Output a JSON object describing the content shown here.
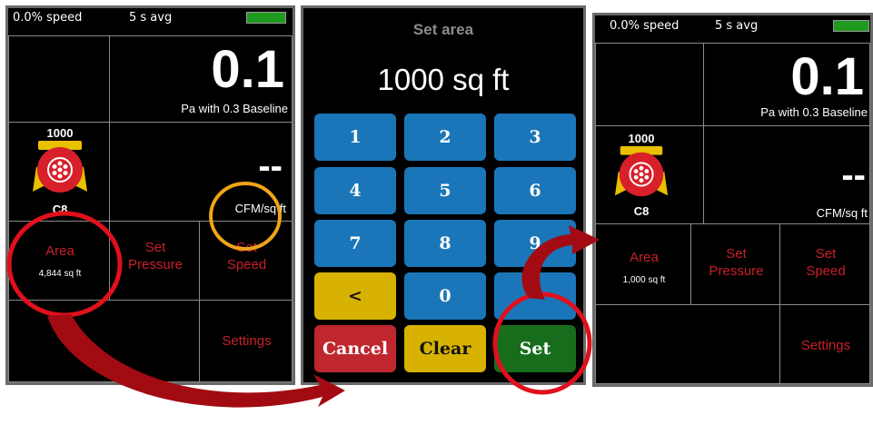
{
  "colors": {
    "background": "#000000",
    "accent_red": "#c8202a",
    "key_blue": "#1a76b8",
    "key_yellow": "#d7b200",
    "key_red": "#c0262d",
    "key_green": "#186d1c",
    "highlight_circle_red": "#e0101c",
    "highlight_circle_orange": "#f0a418"
  },
  "screen1": {
    "speed": "0.0% speed",
    "avg": "5 s avg",
    "reading": "0.1",
    "reading_unit": "Pa with 0.3  Baseline",
    "meter_label_top": "1000",
    "meter_label_bottom": "C8",
    "flow_value": "--",
    "flow_unit": "CFM/sq ft",
    "area_label": "Area",
    "area_value": "4,844 sq ft",
    "set_pressure": "Set\nPressure",
    "set_speed": "Set\nSpeed",
    "settings": "Settings"
  },
  "screen2": {
    "title": "Set area",
    "value": "1000 sq ft",
    "keys": [
      "1",
      "2",
      "3",
      "4",
      "5",
      "6",
      "7",
      "8",
      "9",
      "<",
      "0",
      ""
    ],
    "cancel": "Cancel",
    "clear": "Clear",
    "set": "Set"
  },
  "screen3": {
    "speed": "0.0% speed",
    "avg": "5 s avg",
    "reading": "0.1",
    "reading_unit": "Pa with 0.3  Baseline",
    "meter_label_top": "1000",
    "meter_label_bottom": "C8",
    "flow_value": "--",
    "flow_unit": "CFM/sq ft",
    "area_label": "Area",
    "area_value": "1,000 sq ft",
    "set_pressure": "Set\nPressure",
    "set_speed": "Set\nSpeed",
    "settings": "Settings"
  }
}
